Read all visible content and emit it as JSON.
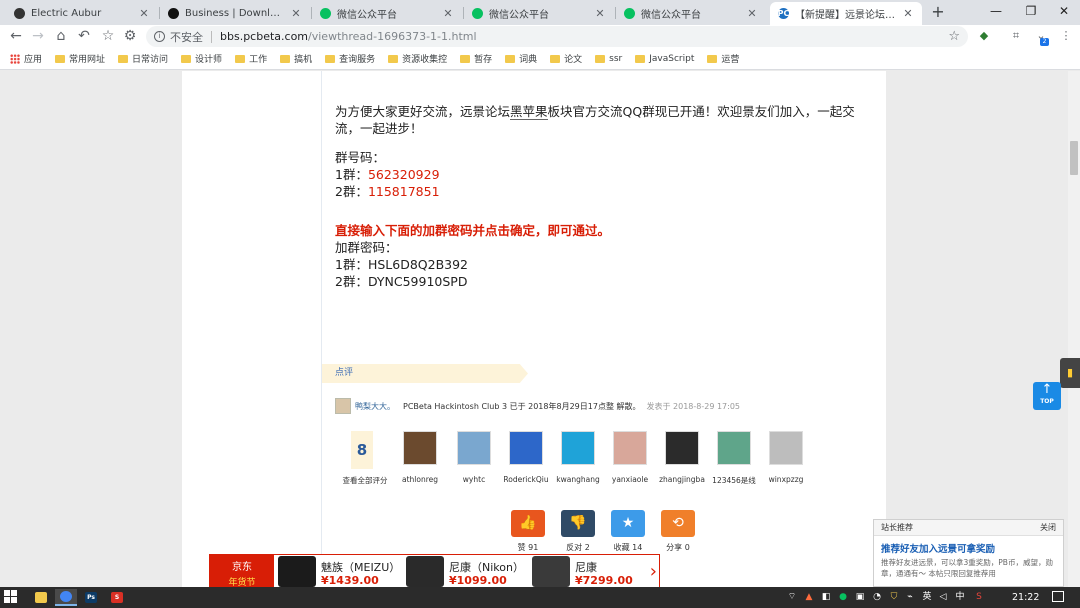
{
  "browser": {
    "tabs": [
      {
        "title": "Electric Aubur",
        "icon": "person-icon"
      },
      {
        "title": "Business | Download Free",
        "icon": "business-icon"
      },
      {
        "title": "微信公众平台",
        "icon": "wechat-icon"
      },
      {
        "title": "微信公众平台",
        "icon": "wechat-icon"
      },
      {
        "title": "微信公众平台",
        "icon": "wechat-icon"
      },
      {
        "title": "【新提醒】远景论坛黑苹果",
        "icon": "pcbeta-icon",
        "icon_text": "PC"
      }
    ],
    "url": {
      "security": "不安全",
      "host": "bbs.pcbeta.com",
      "path": "/viewthread-1696373-1-1.html"
    },
    "extension_badge": "2"
  },
  "bookmarks": [
    {
      "label": "应用",
      "type": "apps"
    },
    {
      "label": "常用网址",
      "type": "folder"
    },
    {
      "label": "日常访问",
      "type": "folder"
    },
    {
      "label": "设计师",
      "type": "folder"
    },
    {
      "label": "工作",
      "type": "folder"
    },
    {
      "label": "搞机",
      "type": "folder"
    },
    {
      "label": "查询服务",
      "type": "folder"
    },
    {
      "label": "资源收集控",
      "type": "folder"
    },
    {
      "label": "暂存",
      "type": "folder"
    },
    {
      "label": "词典",
      "type": "folder"
    },
    {
      "label": "论文",
      "type": "folder"
    },
    {
      "label": "ssr",
      "type": "folder"
    },
    {
      "label": "JavaScript",
      "type": "folder"
    },
    {
      "label": "运营",
      "type": "folder"
    }
  ],
  "post": {
    "intro_prefix": "为方便大家更好交流，远景论坛",
    "intro_link": "黑苹果",
    "intro_suffix": "板块官方交流QQ群现已开通！欢迎景友们加入，一起交流，一起进步！",
    "group_label": "群号码：",
    "group1_prefix": "1群：",
    "group1_number": "562320929",
    "group2_prefix": "2群：",
    "group2_number": "115817851",
    "instruction": "直接输入下面的加群密码并点击确定，即可通过。",
    "password_label": "加群密码：",
    "password1": "1群：HSL6D8Q2B392",
    "password2": "2群：DYNC59910SPD"
  },
  "comment": {
    "tab_label": "点评",
    "user": "鸭梨大大。",
    "rate_text": "PCBeta Hackintosh Club 3 已于 2018年8月29日17点整 解散。",
    "rate_time": "发表于 2018-8-29 17:05",
    "rate_total": "8",
    "rate_total_label": "查看全部评分",
    "raters": [
      {
        "name": "athlonreg",
        "color": "#6b4a2e"
      },
      {
        "name": "wyhtc",
        "color": "#7aa7cf"
      },
      {
        "name": "RoderickQiu",
        "color": "#2d67c9"
      },
      {
        "name": "kwanghang",
        "color": "#1fa3d8"
      },
      {
        "name": "yanxiaole",
        "color": "#d8a79a"
      },
      {
        "name": "zhangjingba",
        "color": "#2b2b2b"
      },
      {
        "name": "123456是线",
        "color": "#5fa58a"
      },
      {
        "name": "winxpzzg",
        "color": "#bdbdbd"
      }
    ]
  },
  "actions": [
    {
      "label": "赞 91",
      "color": "#e8561e",
      "glyph": "👍",
      "icon": "thumbs-up-icon"
    },
    {
      "label": "反对 2",
      "color": "#2f4a66",
      "glyph": "👎",
      "icon": "thumbs-down-icon"
    },
    {
      "label": "收藏 14",
      "color": "#3d9be9",
      "glyph": "★",
      "icon": "star-icon"
    },
    {
      "label": "分享 0",
      "color": "#f07f2a",
      "glyph": "⟲",
      "icon": "share-icon"
    }
  ],
  "ad": {
    "brand": "京东",
    "brand_sub": "年货节",
    "items": [
      {
        "name": "魅族（MEIZU）",
        "price": "¥1439.00",
        "color": "#1b1b1b"
      },
      {
        "name": "尼康（Nikon）",
        "price": "¥1099.00",
        "color": "#2a2a2a"
      },
      {
        "name": "尼康",
        "price": "¥7299.00",
        "color": "#3a3a3a"
      }
    ]
  },
  "top_button": "TOP",
  "popup": {
    "header": "站长推荐",
    "close": "关闭",
    "title": "推荐好友加入远景可拿奖励",
    "text": "推荐好友进远景，可以拿3重奖励，PB币，威望，勋章，通通有～ 本帖只限回复推荐用"
  },
  "taskbar": {
    "time": "21:22",
    "ime": "中",
    "lang": "英",
    "apps": [
      {
        "name": "file-explorer",
        "color": "#f2c94c",
        "text": ""
      },
      {
        "name": "chrome",
        "color": "#4285f4",
        "text": ""
      },
      {
        "name": "photoshop",
        "color": "#0d3b66",
        "text": "Ps"
      },
      {
        "name": "wps",
        "color": "#d93025",
        "text": "S"
      }
    ]
  }
}
